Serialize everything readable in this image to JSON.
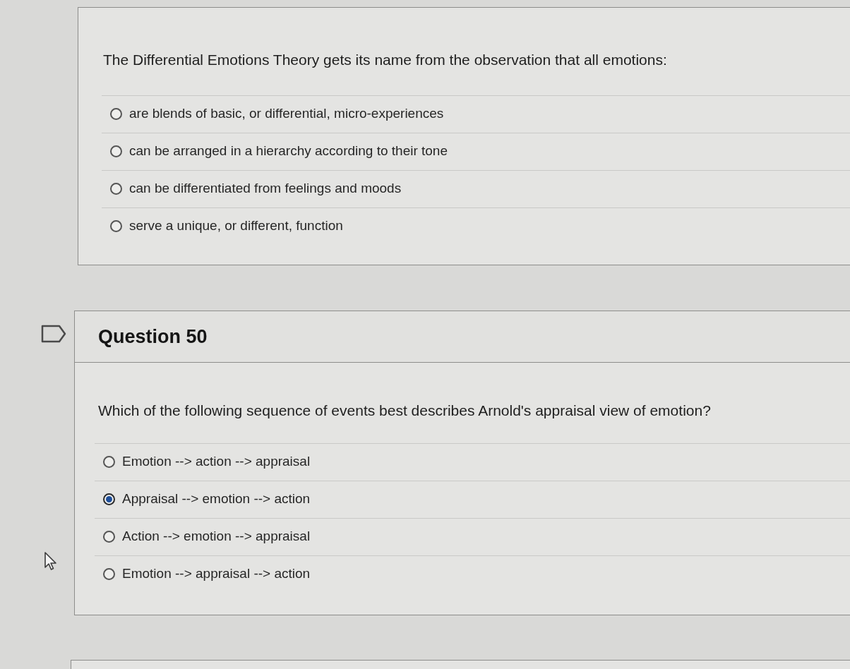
{
  "questions": [
    {
      "prompt": "The Differential Emotions Theory gets its name from the observation that all emotions:",
      "options": [
        {
          "label": "are blends of basic, or differential, micro-experiences",
          "selected": false
        },
        {
          "label": "can be arranged in a hierarchy according to their tone",
          "selected": false
        },
        {
          "label": "can be differentiated from feelings and moods",
          "selected": false
        },
        {
          "label": "serve a unique, or different, function",
          "selected": false
        }
      ]
    },
    {
      "title": "Question 50",
      "flagged": false,
      "prompt": "Which of the following sequence of events best describes Arnold's appraisal view of emotion?",
      "options": [
        {
          "label": "Emotion --> action --> appraisal",
          "selected": false
        },
        {
          "label": "Appraisal --> emotion --> action",
          "selected": true
        },
        {
          "label": "Action --> emotion --> appraisal",
          "selected": false
        },
        {
          "label": "Emotion --> appraisal --> action",
          "selected": false
        }
      ]
    }
  ]
}
